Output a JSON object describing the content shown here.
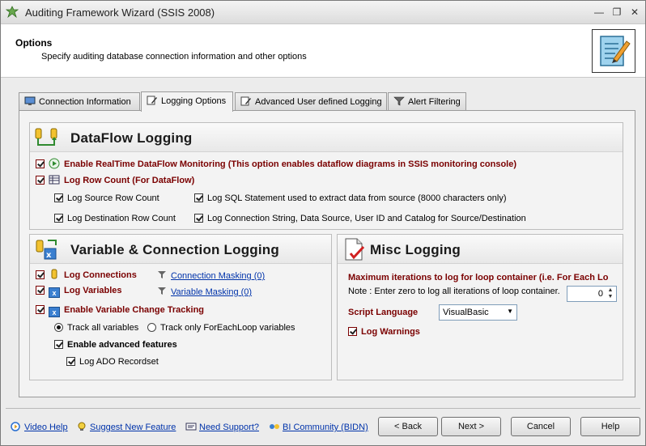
{
  "window": {
    "title": "Auditing Framework Wizard (SSIS 2008)",
    "minimize": "—",
    "restore": "❐",
    "close": "✕"
  },
  "header": {
    "title": "Options",
    "subtitle": "Specify auditing database connection information and other options"
  },
  "tabs": [
    {
      "label": "Connection Information",
      "icon": "monitor-icon"
    },
    {
      "label": "Logging Options",
      "icon": "edit-icon",
      "active": true
    },
    {
      "label": "Advanced User defined Logging",
      "icon": "edit-icon"
    },
    {
      "label": "Alert Filtering",
      "icon": "filter-icon"
    }
  ],
  "dataflow": {
    "title": "DataFlow Logging",
    "realtime": "Enable RealTime DataFlow Monitoring (This option enables dataflow diagrams in SSIS monitoring console)",
    "row_count": "Log Row Count (For DataFlow)",
    "source_row_count": "Log Source Row Count",
    "dest_row_count": "Log Destination Row Count",
    "sql_statement": "Log SQL Statement used to extract data from source (8000 characters only)",
    "conn_string": "Log Connection String, Data Source, User ID and Catalog for Source/Destination"
  },
  "varconn": {
    "title": "Variable & Connection Logging",
    "log_connections": "Log Connections",
    "connection_masking": "Connection Masking (0)",
    "log_variables": "Log Variables",
    "variable_masking": "Variable Masking (0)",
    "change_tracking": "Enable Variable Change Tracking",
    "track_all": "Track all variables",
    "track_foreach": "Track only ForEachLoop variables",
    "advanced_features": "Enable advanced features",
    "ado_recordset": "Log ADO Recordset"
  },
  "misc": {
    "title": "Misc Logging",
    "max_iterations": "Maximum iterations to log for loop container (i.e. For Each Lo",
    "note": "Note : Enter zero to log all iterations of loop container.",
    "iterations_value": "0",
    "script_language_label": "Script Language",
    "script_language_value": "VisualBasic",
    "log_warnings": "Log Warnings"
  },
  "footer": {
    "video_help": "Video Help",
    "suggest": "Suggest New Feature",
    "support": "Need Support?",
    "community": "BI Community (BIDN)",
    "back": "< Back",
    "next": "Next >",
    "cancel": "Cancel",
    "help": "Help"
  },
  "colors": {
    "accent_text": "#7a0000",
    "link": "#0033aa"
  }
}
